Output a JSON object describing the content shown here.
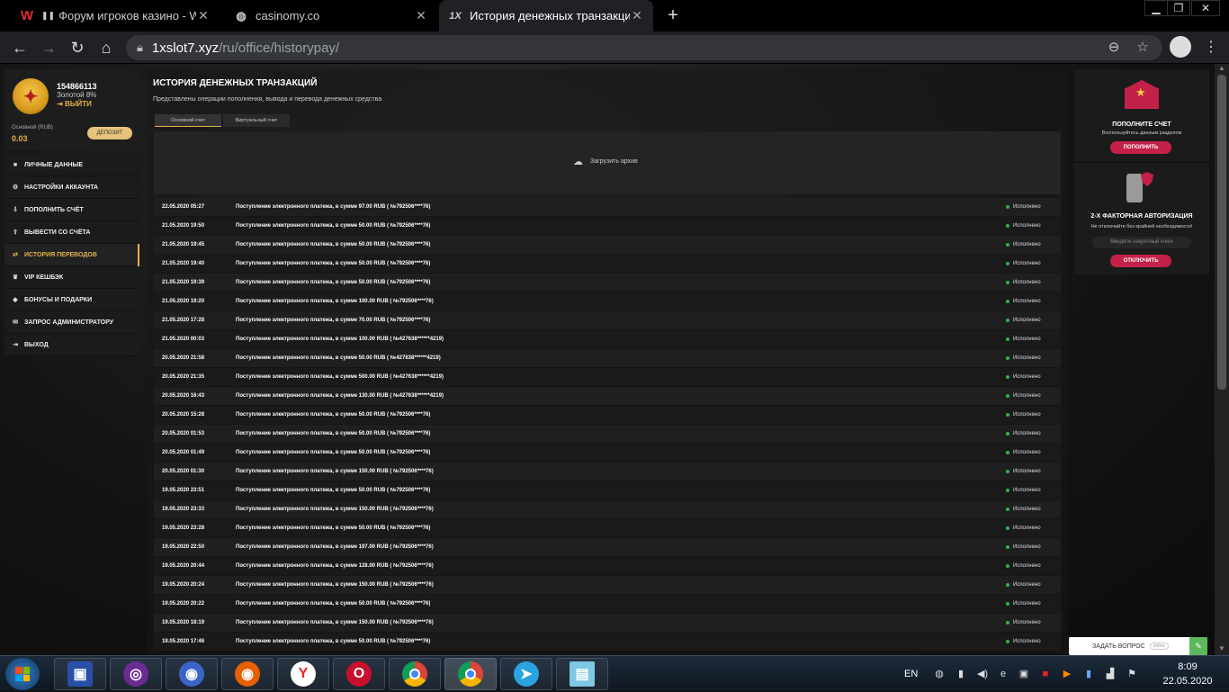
{
  "browser": {
    "tabs": [
      {
        "title": "Форум игроков казино - WIN",
        "favicon": "W",
        "pause": "❚❚"
      },
      {
        "title": "casinomy.co",
        "favicon": "globe"
      },
      {
        "title": "История денежных транзакций",
        "favicon": "1X"
      }
    ],
    "url_host": "1xslot7.xyz",
    "url_path": "/ru/office/historypay/"
  },
  "profile": {
    "user_id": "154866113",
    "level": "Золотой 8%",
    "logout": "ВЫЙТИ",
    "account_label": "Основной (RUB)",
    "balance": "0.03",
    "deposit_button": "ДЕПОЗИТ"
  },
  "menu": [
    {
      "label": "ЛИЧНЫЕ ДАННЫЕ",
      "icon": "user-icon"
    },
    {
      "label": "НАСТРОЙКИ АККАУНТА",
      "icon": "settings-icon"
    },
    {
      "label": "ПОПОЛНИТЬ СЧЁТ",
      "icon": "deposit-icon"
    },
    {
      "label": "ВЫВЕСТИ СО СЧЁТА",
      "icon": "withdraw-icon"
    },
    {
      "label": "ИСТОРИЯ ПЕРЕВОДОВ",
      "icon": "transfer-icon",
      "active": true
    },
    {
      "label": "VIP КЕШБЭК",
      "icon": "vip-icon"
    },
    {
      "label": "БОНУСЫ И ПОДАРКИ",
      "icon": "gift-icon"
    },
    {
      "label": "ЗАПРОС АДМИНИСТРАТОРУ",
      "icon": "mail-icon"
    },
    {
      "label": "ВЫХОД",
      "icon": "exit-icon"
    }
  ],
  "main": {
    "title": "ИСТОРИЯ ДЕНЕЖНЫХ ТРАНЗАКЦИЙ",
    "subtitle": "Представлены операции пополнения, вывода и перевода денежных средства",
    "tabs": [
      "Основной счет",
      "Виртуальный счет"
    ],
    "archive_label": "Загрузить архив"
  },
  "transactions": [
    {
      "date": "22.05.2020 05:27",
      "desc": "Поступление электронного платежа, в сумме 97.00 RUB ( №792506****76)",
      "status": "Исполнено"
    },
    {
      "date": "21.05.2020 19:50",
      "desc": "Поступление электронного платежа, в сумме 50.00 RUB ( №792506****76)",
      "status": "Исполнено"
    },
    {
      "date": "21.05.2020 19:45",
      "desc": "Поступление электронного платежа, в сумме 50.00 RUB ( №792506****76)",
      "status": "Исполнено"
    },
    {
      "date": "21.05.2020 19:40",
      "desc": "Поступление электронного платежа, в сумме 50.00 RUB ( №792506****76)",
      "status": "Исполнено"
    },
    {
      "date": "21.05.2020 19:39",
      "desc": "Поступление электронного платежа, в сумме 50.00 RUB ( №792506****76)",
      "status": "Исполнено"
    },
    {
      "date": "21.05.2020 19:20",
      "desc": "Поступление электронного платежа, в сумме 100.00 RUB ( №792506****76)",
      "status": "Исполнено"
    },
    {
      "date": "21.05.2020 17:28",
      "desc": "Поступление электронного платежа, в сумме 70.00 RUB ( №792506****76)",
      "status": "Исполнено"
    },
    {
      "date": "21.05.2020 00:03",
      "desc": "Поступление электронного платежа, в сумме 100.00 RUB ( №427638******4219)",
      "status": "Исполнено"
    },
    {
      "date": "20.05.2020 21:58",
      "desc": "Поступление электронного платежа, в сумме 50.00 RUB ( №427638******4219)",
      "status": "Исполнено"
    },
    {
      "date": "20.05.2020 21:35",
      "desc": "Поступление электронного платежа, в сумме 500.00 RUB ( №427638******4219)",
      "status": "Исполнено"
    },
    {
      "date": "20.05.2020 16:43",
      "desc": "Поступление электронного платежа, в сумме 130.00 RUB ( №427638******4219)",
      "status": "Исполнено"
    },
    {
      "date": "20.05.2020 15:28",
      "desc": "Поступление электронного платежа, в сумме 50.00 RUB ( №792506****76)",
      "status": "Исполнено"
    },
    {
      "date": "20.05.2020 01:53",
      "desc": "Поступление электронного платежа, в сумме 50.00 RUB ( №792506****76)",
      "status": "Исполнено"
    },
    {
      "date": "20.05.2020 01:49",
      "desc": "Поступление электронного платежа, в сумме 50.00 RUB ( №792506****76)",
      "status": "Исполнено"
    },
    {
      "date": "20.05.2020 01:30",
      "desc": "Поступление электронного платежа, в сумме 150.00 RUB ( №792506****76)",
      "status": "Исполнено"
    },
    {
      "date": "19.05.2020 23:51",
      "desc": "Поступление электронного платежа, в сумме 50.00 RUB ( №792506****76)",
      "status": "Исполнено"
    },
    {
      "date": "19.05.2020 23:33",
      "desc": "Поступление электронного платежа, в сумме 150.00 RUB ( №792506****76)",
      "status": "Исполнено"
    },
    {
      "date": "19.05.2020 23:28",
      "desc": "Поступление электронного платежа, в сумме 50.00 RUB ( №792506****76)",
      "status": "Исполнено"
    },
    {
      "date": "19.05.2020 22:50",
      "desc": "Поступление электронного платежа, в сумме 197.00 RUB ( №792506****76)",
      "status": "Исполнено"
    },
    {
      "date": "19.05.2020 20:44",
      "desc": "Поступление электронного платежа, в сумме 128.00 RUB ( №792506****76)",
      "status": "Исполнено"
    },
    {
      "date": "19.05.2020 20:24",
      "desc": "Поступление электронного платежа, в сумме 150.00 RUB ( №792506****76)",
      "status": "Исполнено"
    },
    {
      "date": "19.05.2020 20:22",
      "desc": "Поступление электронного платежа, в сумме 50.00 RUB ( №792506****76)",
      "status": "Исполнено"
    },
    {
      "date": "19.05.2020 18:19",
      "desc": "Поступление электронного платежа, в сумме 150.00 RUB ( №792506****76)",
      "status": "Исполнено"
    },
    {
      "date": "19.05.2020 17:46",
      "desc": "Поступление электронного платежа, в сумме 50.00 RUB ( №792506****76)",
      "status": "Исполнено"
    }
  ],
  "right": {
    "deposit_card": {
      "title": "ПОПОЛНИТЕ СЧЕТ",
      "subtitle": "Воспользуйтесь данным разделом",
      "button": "ПОПОЛНИТЬ"
    },
    "twofa_card": {
      "title": "2-Х ФАКТОРНАЯ АВТОРИЗАЦИЯ",
      "subtitle": "Не отключайте без крайней необходимости!",
      "placeholder": "Введите секретный ключ",
      "button": "ОТКЛЮЧИТЬ"
    }
  },
  "help_widget": {
    "label": "ЗАДАТЬ ВОПРОС",
    "status": "online"
  },
  "taskbar": {
    "lang": "EN",
    "time": "8:09",
    "date": "22.05.2020"
  },
  "colors": {
    "accent_gold": "#e3b04b",
    "accent_red": "#c42149",
    "status_green": "#2fb34a"
  }
}
